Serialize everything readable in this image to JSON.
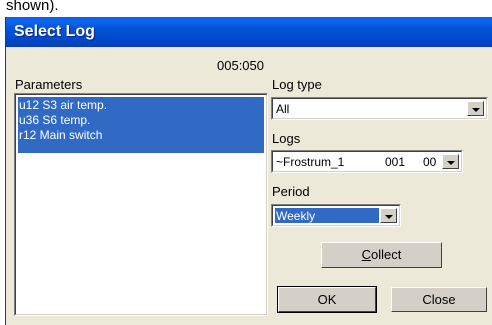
{
  "above_text": "shown).",
  "window": {
    "title": "Select Log"
  },
  "header": {
    "code": "005:050"
  },
  "parameters": {
    "label": "Parameters",
    "items": [
      "u12 S3 air temp.",
      "u36 S6 temp.",
      "r12 Main switch"
    ]
  },
  "log_type": {
    "label": "Log type",
    "value": "All"
  },
  "logs": {
    "label": "Logs",
    "value_name": "~Frostrum_1",
    "value_num": "001",
    "value_extra": "00"
  },
  "period": {
    "label": "Period",
    "value": "Weekly"
  },
  "buttons": {
    "collect_prefix": "",
    "collect_underlined": "C",
    "collect_rest": "ollect",
    "ok": "OK",
    "close": "Close"
  },
  "colors": {
    "title_bar": "#0453d6",
    "selection": "#316ac5",
    "dialog_face": "#ece9d8"
  }
}
